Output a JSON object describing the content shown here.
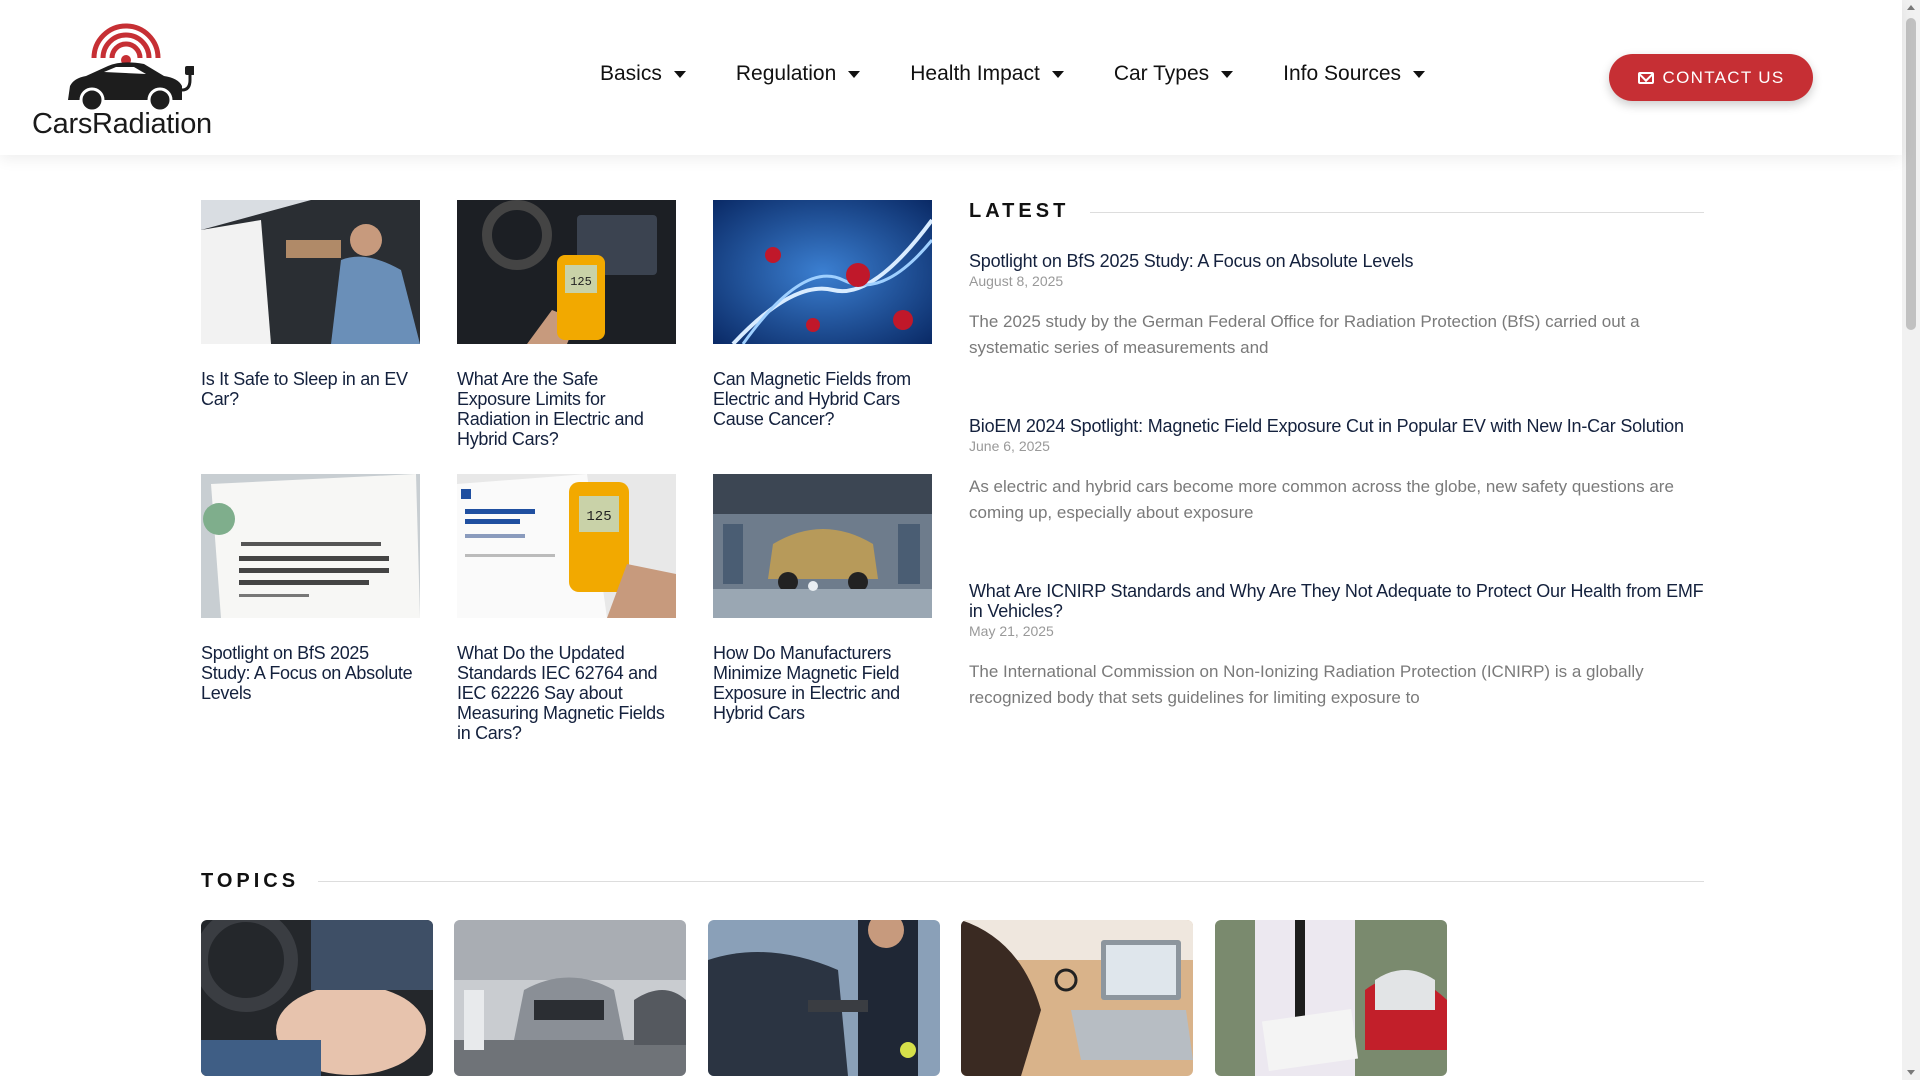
{
  "brand": {
    "name": "CarsRadiation",
    "accent": "#c62f34"
  },
  "nav": [
    {
      "label": "Basics"
    },
    {
      "label": "Regulation"
    },
    {
      "label": "Health Impact"
    },
    {
      "label": "Car Types"
    },
    {
      "label": "Info Sources"
    }
  ],
  "contact": {
    "label": "CONTACT US",
    "icon": "mail-icon"
  },
  "articles": [
    {
      "title": "Is It Safe to Sleep in an EV Car?"
    },
    {
      "title": "What Are the Safe Exposure Limits for Radiation in Electric and Hybrid Cars?"
    },
    {
      "title": "Can Magnetic Fields from Electric and Hybrid Cars Cause Cancer?"
    },
    {
      "title": "Spotlight on BfS 2025 Study: A Focus on Absolute Levels"
    },
    {
      "title": "What Do the Updated Standards IEC 62764 and IEC 62226 Say about Measuring Magnetic Fields in Cars?"
    },
    {
      "title": "How Do Manufacturers Minimize Magnetic Field Exposure in Electric and Hybrid Cars"
    }
  ],
  "latest": {
    "heading": "LATEST",
    "items": [
      {
        "title": "Spotlight on BfS 2025 Study: A Focus on Absolute Levels",
        "date": "August 8, 2025",
        "excerpt": "The 2025 study by the German Federal Office for Radiation Protection (BfS) carried out a systematic series of measurements and"
      },
      {
        "title": "BioEM 2024 Spotlight: Magnetic Field Exposure Cut in Popular EV with New In-Car Solution",
        "date": "June 6, 2025",
        "excerpt": "As electric and hybrid cars become more common across the globe, new safety questions are coming up, especially about exposure"
      },
      {
        "title": "What Are ICNIRP Standards and Why Are They Not Adequate to Protect Our Health from EMF in Vehicles?",
        "date": "May 21, 2025",
        "excerpt": "The International Commission on Non-Ionizing Radiation Protection (ICNIRP) is a globally recognized body that sets guidelines for limiting exposure to"
      }
    ]
  },
  "topics": {
    "heading": "TOPICS"
  }
}
